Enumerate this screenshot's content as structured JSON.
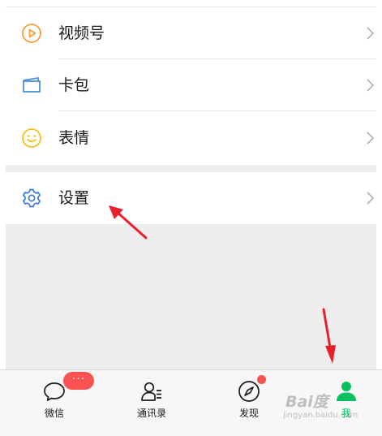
{
  "menu": {
    "items": [
      {
        "label": "视频号",
        "icon": "channels-play-icon",
        "color": "#fa9d3b"
      },
      {
        "label": "卡包",
        "icon": "card-wallet-icon",
        "color": "#4a90d9"
      },
      {
        "label": "表情",
        "icon": "smiley-icon",
        "color": "#f5c01a"
      }
    ],
    "settings": {
      "label": "设置",
      "icon": "gear-icon",
      "color": "#3d7bd8"
    }
  },
  "tabbar": {
    "tabs": [
      {
        "label": "微信",
        "icon": "chat-bubble-icon",
        "badge": "···"
      },
      {
        "label": "通讯录",
        "icon": "contacts-icon"
      },
      {
        "label": "发现",
        "icon": "compass-icon",
        "dot": true
      },
      {
        "label": "我",
        "icon": "me-person-icon",
        "active": true
      }
    ],
    "active_color": "#07c160",
    "badge_color": "#fa5151"
  },
  "annotations": {
    "arrow_color": "#e8202a"
  },
  "watermark": {
    "text": "Bai度",
    "sub": "jingyan.baidu.com"
  }
}
